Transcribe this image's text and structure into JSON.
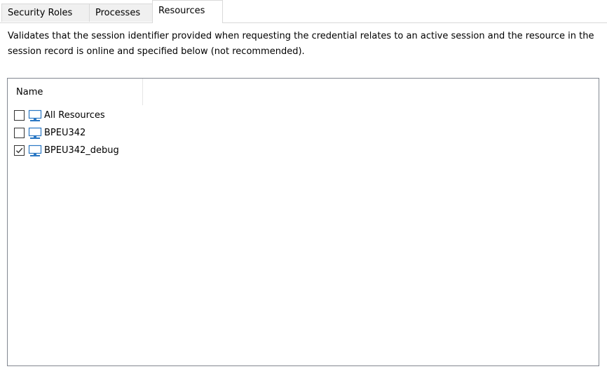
{
  "tabs": [
    {
      "label": "Security Roles",
      "active": false
    },
    {
      "label": "Processes",
      "active": false
    },
    {
      "label": "Resources",
      "active": true
    }
  ],
  "description": "Validates that the session identifier provided when requesting the credential relates to an active session and the resource in the session record is online and specified below (not recommended).",
  "list": {
    "column_header": "Name",
    "items": [
      {
        "label": "All Resources",
        "checked": false,
        "icon": "computer-icon"
      },
      {
        "label": "BPEU342",
        "checked": false,
        "icon": "computer-icon"
      },
      {
        "label": "BPEU342_debug",
        "checked": true,
        "icon": "computer-icon"
      }
    ]
  },
  "colors": {
    "tab_border": "#d9d9d9",
    "tab_inactive_bg": "#f0f0f0",
    "list_border": "#828790",
    "icon_blue": "#2b78c4"
  }
}
